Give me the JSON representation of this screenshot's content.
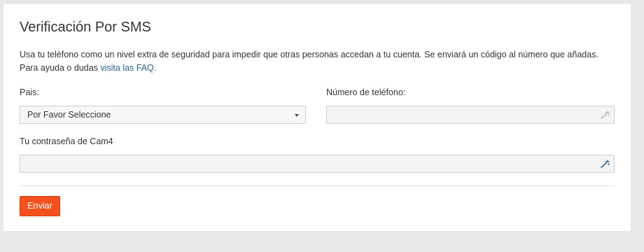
{
  "page": {
    "title": "Verificación Por SMS",
    "intro_text": "Usa tu teléfono como un nivel extra de seguridad para impedir que otras personas accedan a tu cuenta. Se enviará un código al número que añadas. Para ayuda o dudas ",
    "faq_link": "visita las FAQ."
  },
  "form": {
    "country_label": "Pais:",
    "country_selected": "Por Favor Seleccione",
    "phone_label": "Número de teléfono:",
    "phone_value": "",
    "password_label": "Tu contraseña de Cam4",
    "password_value": "",
    "submit_label": "Enviar"
  },
  "icons": {
    "select_caret": "chevron-down-icon",
    "phone_field_icon": "key-icon",
    "password_field_icon": "key-icon"
  },
  "colors": {
    "background": "#e8e8e8",
    "panel": "#ffffff",
    "link": "#2a6496",
    "primary_button": "#f4511e",
    "key_icon_inactive": "#b8b8b8",
    "key_icon_active": "#2a6496"
  }
}
